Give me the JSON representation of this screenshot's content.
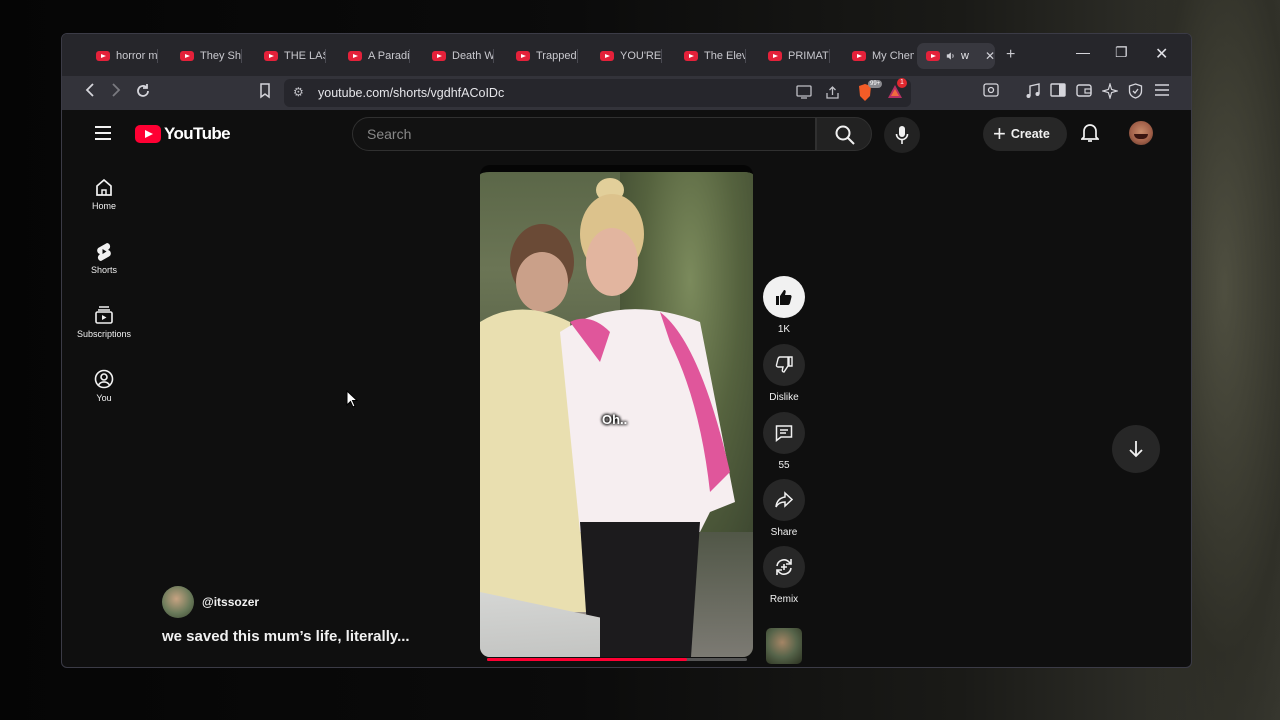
{
  "browser": {
    "tabs": [
      {
        "title": "horror m"
      },
      {
        "title": "They Sho"
      },
      {
        "title": "THE LAS"
      },
      {
        "title": "A Paradis"
      },
      {
        "title": "Death W"
      },
      {
        "title": "Trapped"
      },
      {
        "title": "YOU'RE I"
      },
      {
        "title": "The Eleve"
      },
      {
        "title": "PRIMATE"
      },
      {
        "title": "My Chem"
      }
    ],
    "active_tab": {
      "title": "w",
      "audio_icon": "speaker-icon"
    },
    "new_tab": "+",
    "url": "youtube.com/shorts/vgdhfACoIDc",
    "brave_shield_count": "99+",
    "rewards_badge": "1"
  },
  "youtube": {
    "logo_text": "YouTube",
    "search_placeholder": "Search",
    "create_label": "Create",
    "sidebar": [
      {
        "label": "Home",
        "icon": "home-icon"
      },
      {
        "label": "Shorts",
        "icon": "shorts-icon"
      },
      {
        "label": "Subscriptions",
        "icon": "subscriptions-icon"
      },
      {
        "label": "You",
        "icon": "you-icon"
      }
    ],
    "short": {
      "caption": "Oh..",
      "channel_handle": "@itssozer",
      "title": "we saved this mum’s life, literally...",
      "progress": 0.77
    },
    "actions": {
      "like_count": "1K",
      "dislike_label": "Dislike",
      "comment_count": "55",
      "share_label": "Share",
      "remix_label": "Remix"
    }
  },
  "colors": {
    "accent": "#ff0033",
    "background": "#0f0f0f"
  }
}
